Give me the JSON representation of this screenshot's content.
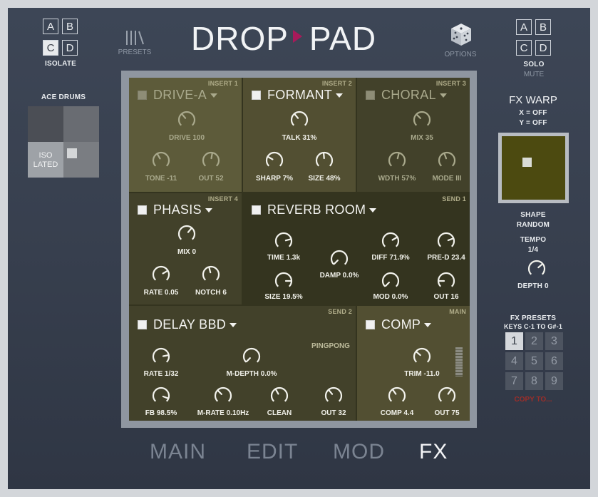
{
  "header": {
    "isolate": {
      "buttons": [
        "A",
        "B",
        "C",
        "D"
      ],
      "active": "C",
      "label": "ISOLATE"
    },
    "presets_label": "PRESETS",
    "logo_left": "DROP",
    "logo_right": "PAD",
    "options_label": "OPTIONS",
    "solo": {
      "buttons": [
        "A",
        "B",
        "C",
        "D"
      ],
      "label": "SOLO",
      "sublabel": "MUTE"
    }
  },
  "left": {
    "pad_title": "ACE DRUMS",
    "iso_line1": "ISO",
    "iso_line2": "LATED"
  },
  "right": {
    "warp_title": "FX WARP",
    "warp_x": "X = OFF",
    "warp_y": "Y = OFF",
    "shape_label": "SHAPE",
    "shape_value": "RANDOM",
    "tempo_label": "TEMPO",
    "tempo_value": "1/4",
    "depth_label": "DEPTH 0",
    "presets_title": "FX PRESETS",
    "presets_keys": "KEYS C-1 TO G#-1",
    "preset_buttons": [
      "1",
      "2",
      "3",
      "4",
      "5",
      "6",
      "7",
      "8",
      "9"
    ],
    "preset_active": "1",
    "copy_to": "COPY TO..."
  },
  "slots": {
    "drive": {
      "slot": "INSERT 1",
      "name": "DRIVE-A",
      "knobs": [
        "DRIVE 100",
        "TONE -11",
        "OUT 52"
      ]
    },
    "formant": {
      "slot": "INSERT 2",
      "name": "FORMANT",
      "knobs": [
        "TALK 31%",
        "SHARP 7%",
        "SIZE 48%"
      ]
    },
    "choral": {
      "slot": "INSERT 3",
      "name": "CHORAL",
      "knobs": [
        "MIX 35",
        "WDTH 57%",
        "MODE III"
      ]
    },
    "phasis": {
      "slot": "INSERT 4",
      "name": "PHASIS",
      "knobs": [
        "MIX 0",
        "RATE 0.05",
        "NOTCH 6"
      ]
    },
    "reverb": {
      "slot": "SEND 1",
      "name": "REVERB ROOM",
      "knobs": [
        "TIME 1.3k",
        "SIZE 19.5%",
        "DAMP 0.0%",
        "DIFF 71.9%",
        "PRE-D 23.4",
        "MOD 0.0%",
        "OUT 16"
      ]
    },
    "delay": {
      "slot": "SEND 2",
      "name": "DELAY BBD",
      "pingpong": "PINGPONG",
      "knobs": [
        "RATE 1/32",
        "M-DEPTH 0.0%",
        "FB 98.5%",
        "M-RATE 0.10Hz",
        "CLEAN",
        "OUT 32"
      ]
    },
    "comp": {
      "slot": "MAIN",
      "name": "COMP",
      "knobs": [
        "TRIM -11.0",
        "COMP 4.4",
        "OUT 75"
      ]
    }
  },
  "tabs": [
    "MAIN",
    "EDIT",
    "MOD",
    "FX"
  ],
  "active_tab": "FX",
  "colors": {
    "accent": "#a81a5a",
    "active_cell": "#524f32",
    "panel": "#3a4150"
  }
}
